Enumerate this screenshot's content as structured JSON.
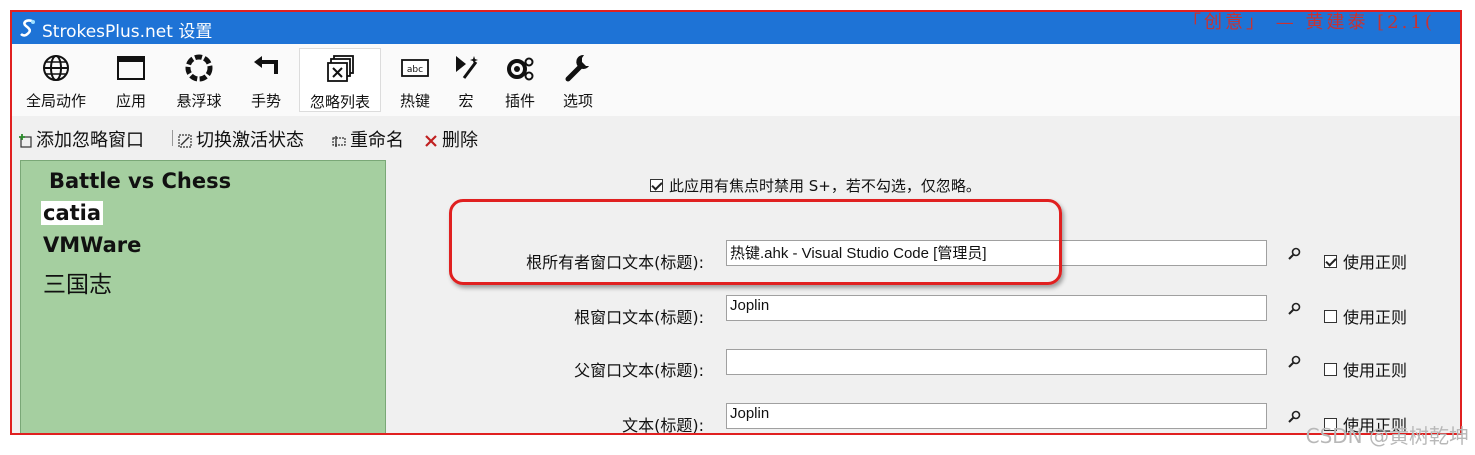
{
  "window": {
    "title": "StrokesPlus.net 设置"
  },
  "watermark_top": "「创意」 — 黄建泰 [2.1(",
  "toolbar": [
    {
      "id": "global-actions",
      "label": "全局动作",
      "icon": "globe-icon"
    },
    {
      "id": "apps",
      "label": "应用",
      "icon": "window-icon"
    },
    {
      "id": "floater",
      "label": "悬浮球",
      "icon": "ring-icon"
    },
    {
      "id": "gestures",
      "label": "手势",
      "icon": "turn-arrow-icon"
    },
    {
      "id": "ignore-list",
      "label": "忽略列表",
      "icon": "ignore-windows-icon",
      "active": true
    },
    {
      "id": "hotkeys",
      "label": "热键",
      "icon": "abc-key-icon"
    },
    {
      "id": "macros",
      "label": "宏",
      "icon": "magic-wand-icon"
    },
    {
      "id": "plugins",
      "label": "插件",
      "icon": "plugin-icon"
    },
    {
      "id": "options",
      "label": "选项",
      "icon": "wrench-icon"
    }
  ],
  "actions": {
    "add": "添加忽略窗口",
    "toggle": "切换激活状态",
    "rename": "重命名",
    "delete": "删除"
  },
  "ignore_list": [
    "Battle vs Chess",
    "catia",
    "VMWare",
    "三国志"
  ],
  "form": {
    "disable_on_focus_label": "此应用有焦点时禁用 S+，若不勾选，仅忽略。",
    "disable_on_focus_checked": true,
    "rows": [
      {
        "label": "根所有者窗口文本(标题):",
        "value": "热键.ahk - Visual Studio Code [管理员]",
        "regex_label": "使用正则",
        "regex_checked": true
      },
      {
        "label": "根窗口文本(标题):",
        "value": "Joplin",
        "regex_label": "使用正则",
        "regex_checked": false
      },
      {
        "label": "父窗口文本(标题):",
        "value": "",
        "regex_label": "使用正则",
        "regex_checked": false
      },
      {
        "label": "文本(标题):",
        "value": "Joplin",
        "regex_label": "使用正则",
        "regex_checked": false
      }
    ]
  },
  "watermark_bottom": "CSDN @黄树乾坤",
  "colors": {
    "titlebar": "#1e73d6",
    "list_bg": "#a5cfa0",
    "highlight": "#e02020"
  }
}
